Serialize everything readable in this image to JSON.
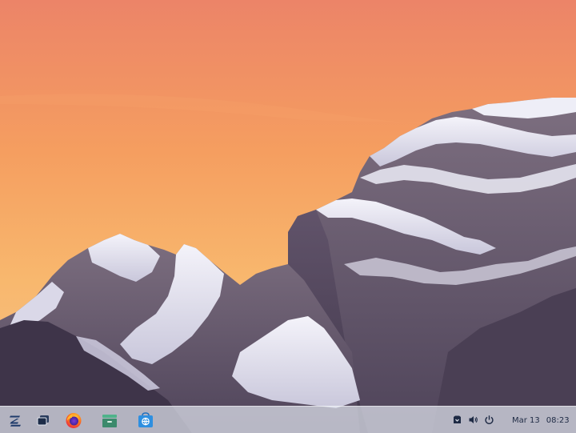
{
  "desktop": {
    "wallpaper": {
      "subject": "snow-capped-mountains-at-sunset",
      "sky_top_color": "#ef8f6a",
      "sky_mid_color": "#f7a95e",
      "sky_horizon_color": "#f9c07a",
      "mountain_color": "#6b5a6e",
      "snow_color": "#eef0f8"
    }
  },
  "taskbar": {
    "background_color": "#e1e5ee",
    "pinned_apps": [
      {
        "name": "zorin-menu",
        "icon": "zorin-logo-icon"
      },
      {
        "name": "show-desktop",
        "icon": "windows-overview-icon"
      },
      {
        "name": "firefox",
        "icon": "firefox-icon"
      },
      {
        "name": "files",
        "icon": "file-manager-icon"
      },
      {
        "name": "software",
        "icon": "software-store-icon"
      }
    ],
    "tray": {
      "icons": [
        "notification-icon",
        "volume-icon",
        "power-icon"
      ]
    },
    "clock": {
      "date": "Mar 13",
      "time": "08:23"
    }
  }
}
